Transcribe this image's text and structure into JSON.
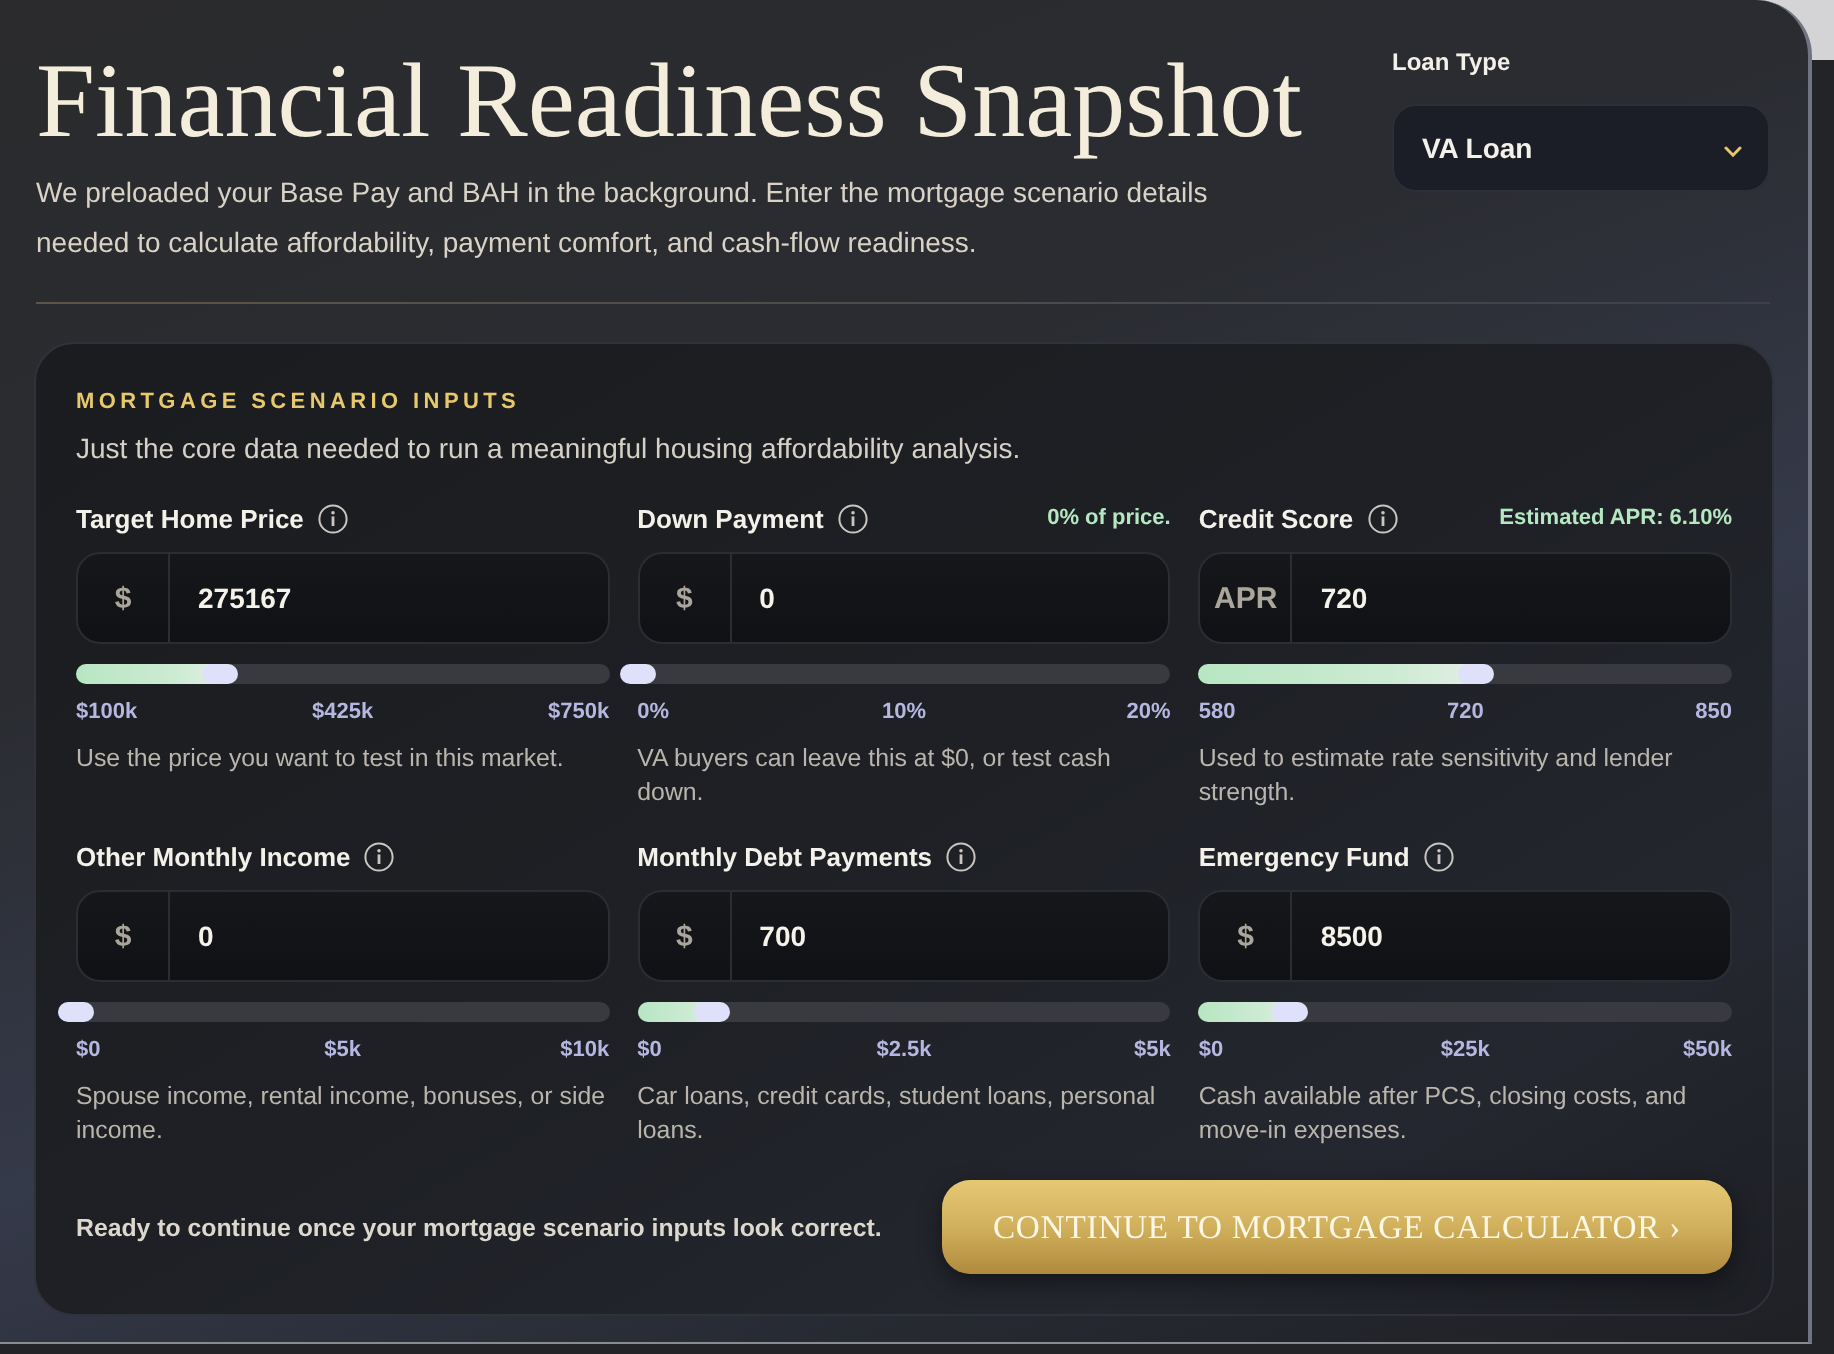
{
  "header": {
    "title": "Financial Readiness Snapshot",
    "subtitle": "We preloaded your Base Pay and BAH in the background. Enter the mortgage scenario details needed to calculate affordability, payment comfort, and cash-flow readiness."
  },
  "loan_type": {
    "label": "Loan Type",
    "value": "VA Loan"
  },
  "scenario_inputs": {
    "heading": "MORTGAGE SCENARIO INPUTS",
    "description": "Just the core data needed to run a meaningful housing affordability analysis.",
    "fields": [
      {
        "label": "Target Home Price",
        "prefix": "$",
        "value": "275167",
        "level": 0.27,
        "ticks": [
          "$100k",
          "$425k",
          "$750k"
        ],
        "help": "Use the price you want to test in this market."
      },
      {
        "label": "Down Payment",
        "note": "0% of price.",
        "prefix": "$",
        "value": "0",
        "level": 0,
        "ticks": [
          "0%",
          "10%",
          "20%"
        ],
        "help": "VA buyers can leave this at $0, or test cash down."
      },
      {
        "label": "Credit Score",
        "note": "Estimated APR: 6.10%",
        "prefix": "APR",
        "value": "720",
        "level": 0.52,
        "ticks": [
          "580",
          "720",
          "850"
        ],
        "help": "Used to estimate rate sensitivity and lender strength."
      },
      {
        "label": "Other Monthly Income",
        "prefix": "$",
        "value": "0",
        "level": 0,
        "ticks": [
          "$0",
          "$5k",
          "$10k"
        ],
        "help": "Spouse income, rental income, bonuses, or side income."
      },
      {
        "label": "Monthly Debt Payments",
        "prefix": "$",
        "value": "700",
        "level": 0.14,
        "ticks": [
          "$0",
          "$2.5k",
          "$5k"
        ],
        "help": "Car loans, credit cards, student loans, personal loans."
      },
      {
        "label": "Emergency Fund",
        "prefix": "$",
        "value": "8500",
        "level": 0.17,
        "ticks": [
          "$0",
          "$25k",
          "$50k"
        ],
        "help": "Cash available after PCS, closing costs, and move-in expenses."
      }
    ],
    "status": "Ready to continue once your mortgage scenario inputs look correct.",
    "button": "CONTINUE TO MORTGAGE CALCULATOR ›"
  }
}
